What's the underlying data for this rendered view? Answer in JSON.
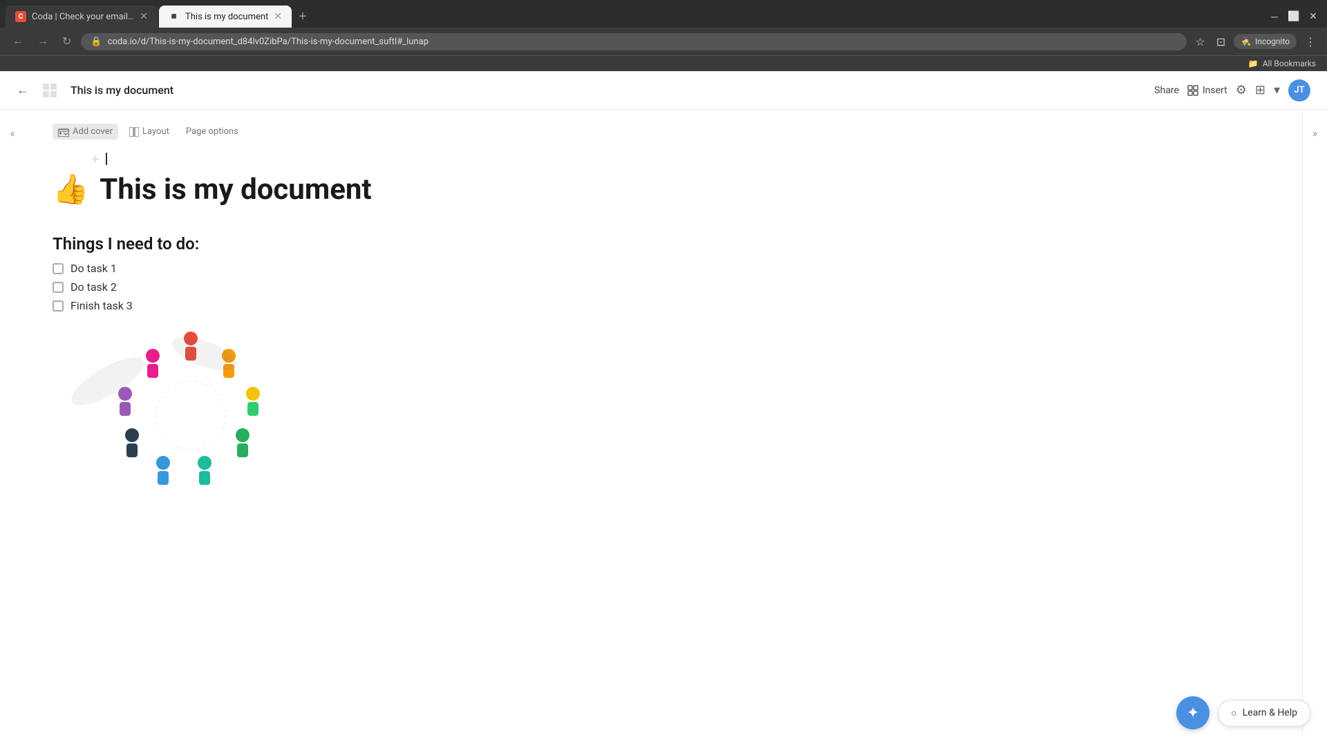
{
  "browser": {
    "tabs": [
      {
        "id": "tab1",
        "title": "Coda | Check your email to fi...",
        "favicon": "C",
        "active": false,
        "url": ""
      },
      {
        "id": "tab2",
        "title": "This is my document",
        "favicon": "◾",
        "active": true,
        "url": ""
      }
    ],
    "address": "coda.io/d/This-is-my-document_d84lv0ZibPa/This-is-my-document_suftl#_lunap",
    "incognito_label": "Incognito",
    "bookmarks_label": "All Bookmarks"
  },
  "header": {
    "back_label": "←",
    "doc_title": "This is my document",
    "share_label": "Share",
    "insert_label": "Insert",
    "avatar_initials": "JT"
  },
  "sidebar": {
    "expand_icon": "«"
  },
  "toolbar": {
    "add_cover_label": "Add cover",
    "layout_label": "Layout",
    "page_options_label": "Page options"
  },
  "document": {
    "emoji": "👍",
    "title": "This is my document",
    "section_heading": "Things I need to do:",
    "tasks": [
      {
        "id": "task1",
        "label": "Do task 1",
        "checked": false
      },
      {
        "id": "task2",
        "label": "Do task 2",
        "checked": false
      },
      {
        "id": "task3",
        "label": "Finish task 3",
        "checked": false
      }
    ]
  },
  "help": {
    "sparkle_icon": "✦",
    "learn_help_label": "Learn & Help",
    "help_icon": "?"
  },
  "right_panel": {
    "collapse_icon": "»"
  }
}
